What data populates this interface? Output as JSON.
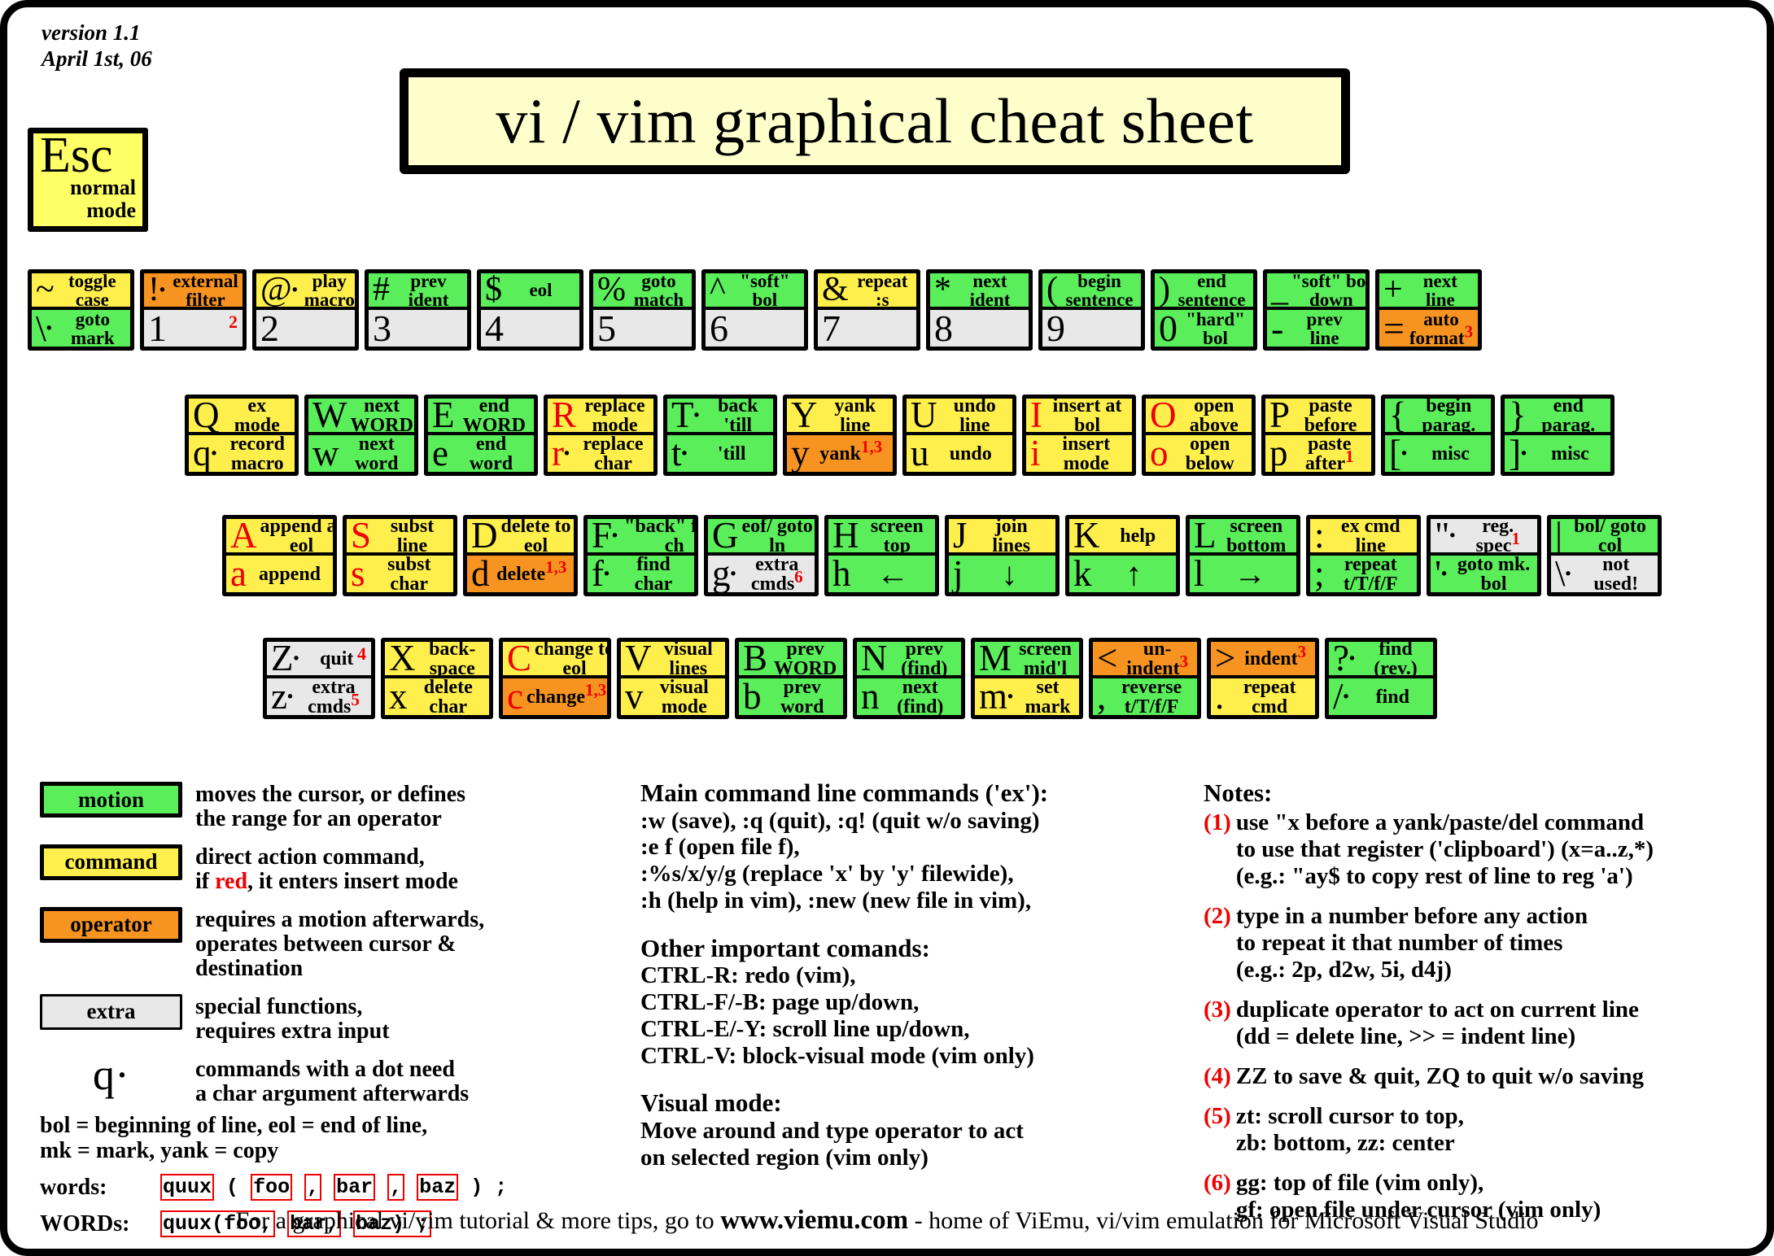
{
  "meta": {
    "version_line1": "version 1.1",
    "version_line2": "April 1st, 06",
    "title": "vi / vim graphical cheat sheet"
  },
  "esc_key": {
    "char": "Esc",
    "label_line1": "normal",
    "label_line2": "mode"
  },
  "rows": {
    "number_row": [
      {
        "top": {
          "char": "~",
          "label": "toggle case",
          "color": "command"
        },
        "bottom": {
          "char": "\\",
          "dot": true,
          "label": "goto mark",
          "color": "motion"
        }
      },
      {
        "top": {
          "char": "!",
          "dot": true,
          "label": "external filter",
          "color": "operator"
        },
        "bottom": {
          "char": "1",
          "label": "",
          "color": "plain",
          "corner_note": "2"
        }
      },
      {
        "top": {
          "char": "@",
          "dot": true,
          "label": "play macro",
          "color": "command"
        },
        "bottom": {
          "char": "2",
          "label": "",
          "color": "plain"
        }
      },
      {
        "top": {
          "char": "#",
          "label": "prev ident",
          "color": "motion"
        },
        "bottom": {
          "char": "3",
          "label": "",
          "color": "plain"
        }
      },
      {
        "top": {
          "char": "$",
          "label": "eol",
          "color": "motion"
        },
        "bottom": {
          "char": "4",
          "label": "",
          "color": "plain"
        }
      },
      {
        "top": {
          "char": "%",
          "label": "goto match",
          "color": "motion"
        },
        "bottom": {
          "char": "5",
          "label": "",
          "color": "plain"
        }
      },
      {
        "top": {
          "char": "^",
          "label": "\"soft\" bol",
          "color": "motion"
        },
        "bottom": {
          "char": "6",
          "label": "",
          "color": "plain"
        }
      },
      {
        "top": {
          "char": "&",
          "label": "repeat :s",
          "color": "command"
        },
        "bottom": {
          "char": "7",
          "label": "",
          "color": "plain"
        }
      },
      {
        "top": {
          "char": "*",
          "label": "next ident",
          "color": "motion"
        },
        "bottom": {
          "char": "8",
          "label": "",
          "color": "plain"
        }
      },
      {
        "top": {
          "char": "(",
          "label": "begin sentence",
          "color": "motion"
        },
        "bottom": {
          "char": "9",
          "label": "",
          "color": "plain"
        }
      },
      {
        "top": {
          "char": ")",
          "label": "end sentence",
          "color": "motion"
        },
        "bottom": {
          "char": "0",
          "label": "\"hard\" bol",
          "color": "motion"
        }
      },
      {
        "top": {
          "char": "_",
          "label": "\"soft\" bol down",
          "color": "motion",
          "label_above": true
        },
        "bottom": {
          "char": "-",
          "label": "prev line",
          "color": "motion"
        }
      },
      {
        "top": {
          "char": "+",
          "label": "next line",
          "color": "motion"
        },
        "bottom": {
          "char": "=",
          "label": "auto format",
          "color": "operator",
          "sup": "3"
        }
      }
    ],
    "q_row": [
      {
        "top": {
          "char": "Q",
          "label": "ex mode",
          "color": "command"
        },
        "bottom": {
          "char": "q",
          "dot": true,
          "label": "record macro",
          "color": "command"
        }
      },
      {
        "top": {
          "char": "W",
          "label": "next WORD",
          "color": "motion"
        },
        "bottom": {
          "char": "w",
          "label": "next word",
          "color": "motion"
        }
      },
      {
        "top": {
          "char": "E",
          "label": "end WORD",
          "color": "motion"
        },
        "bottom": {
          "char": "e",
          "label": "end word",
          "color": "motion"
        }
      },
      {
        "top": {
          "char": "R",
          "label": "replace mode",
          "color": "command",
          "red": true
        },
        "bottom": {
          "char": "r",
          "dot": true,
          "label": "replace char",
          "color": "command",
          "red": true
        }
      },
      {
        "top": {
          "char": "T",
          "dot": true,
          "label": "back 'till",
          "color": "motion"
        },
        "bottom": {
          "char": "t",
          "dot": true,
          "label": "'till",
          "color": "motion"
        }
      },
      {
        "top": {
          "char": "Y",
          "label": "yank line",
          "color": "command"
        },
        "bottom": {
          "char": "y",
          "label": "yank",
          "color": "operator",
          "sup": "1,3"
        }
      },
      {
        "top": {
          "char": "U",
          "label": "undo line",
          "color": "command"
        },
        "bottom": {
          "char": "u",
          "label": "undo",
          "color": "command"
        }
      },
      {
        "top": {
          "char": "I",
          "label": "insert at bol",
          "color": "command",
          "red": true
        },
        "bottom": {
          "char": "i",
          "label": "insert mode",
          "color": "command",
          "red": true
        }
      },
      {
        "top": {
          "char": "O",
          "label": "open above",
          "color": "command",
          "red": true
        },
        "bottom": {
          "char": "o",
          "label": "open below",
          "color": "command",
          "red": true
        }
      },
      {
        "top": {
          "char": "P",
          "label": "paste before",
          "color": "command"
        },
        "bottom": {
          "char": "p",
          "label": "paste after",
          "color": "command",
          "sup": "1"
        }
      },
      {
        "top": {
          "char": "{",
          "label": "begin parag.",
          "color": "motion"
        },
        "bottom": {
          "char": "[",
          "dot": true,
          "label": "misc",
          "color": "motion"
        }
      },
      {
        "top": {
          "char": "}",
          "label": "end parag.",
          "color": "motion"
        },
        "bottom": {
          "char": "]",
          "dot": true,
          "label": "misc",
          "color": "motion"
        }
      }
    ],
    "a_row": [
      {
        "top": {
          "char": "A",
          "label": "append at eol",
          "color": "command",
          "red": true
        },
        "bottom": {
          "char": "a",
          "label": "append",
          "color": "command",
          "red": true
        }
      },
      {
        "top": {
          "char": "S",
          "label": "subst line",
          "color": "command",
          "red": true
        },
        "bottom": {
          "char": "s",
          "label": "subst char",
          "color": "command",
          "red": true
        }
      },
      {
        "top": {
          "char": "D",
          "label": "delete to eol",
          "color": "command"
        },
        "bottom": {
          "char": "d",
          "label": "delete",
          "color": "operator",
          "sup": "1,3"
        }
      },
      {
        "top": {
          "char": "F",
          "dot": true,
          "label": "\"back\" find ch",
          "color": "motion"
        },
        "bottom": {
          "char": "f",
          "dot": true,
          "label": "find char",
          "color": "motion"
        }
      },
      {
        "top": {
          "char": "G",
          "label": "eof/ goto ln",
          "color": "motion"
        },
        "bottom": {
          "char": "g",
          "dot": true,
          "label": "extra cmds",
          "color": "extra",
          "sup": "6"
        }
      },
      {
        "top": {
          "char": "H",
          "label": "screen top",
          "color": "motion"
        },
        "bottom": {
          "char": "h",
          "label": "←",
          "color": "motion",
          "is_arrow": true
        }
      },
      {
        "top": {
          "char": "J",
          "label": "join lines",
          "color": "command"
        },
        "bottom": {
          "char": "j",
          "label": "↓",
          "color": "motion",
          "is_arrow": true
        }
      },
      {
        "top": {
          "char": "K",
          "label": "help",
          "color": "command"
        },
        "bottom": {
          "char": "k",
          "label": "↑",
          "color": "motion",
          "is_arrow": true
        }
      },
      {
        "top": {
          "char": "L",
          "label": "screen bottom",
          "color": "motion"
        },
        "bottom": {
          "char": "l",
          "label": "→",
          "color": "motion",
          "is_arrow": true
        }
      },
      {
        "top": {
          "char": ":",
          "label": "ex cmd line",
          "color": "command"
        },
        "bottom": {
          "char": ";",
          "label": "repeat t/T/f/F",
          "color": "motion"
        }
      },
      {
        "top": {
          "char": "\"",
          "dot": true,
          "label": "reg. spec",
          "color": "extra",
          "sup": "1"
        },
        "bottom": {
          "char": "'",
          "dot": true,
          "label": "goto mk. bol",
          "color": "motion"
        }
      },
      {
        "top": {
          "char": "|",
          "label": "bol/ goto col",
          "color": "motion"
        },
        "bottom": {
          "char": "\\",
          "dot": true,
          "label": "not used!",
          "color": "extra"
        }
      }
    ],
    "z_row": [
      {
        "top": {
          "char": "Z",
          "dot": true,
          "label": "quit",
          "color": "extra",
          "corner_note": "4"
        },
        "bottom": {
          "char": "z",
          "dot": true,
          "label": "extra cmds",
          "color": "extra",
          "sup": "5"
        }
      },
      {
        "top": {
          "char": "X",
          "label": "back- space",
          "color": "command"
        },
        "bottom": {
          "char": "x",
          "label": "delete char",
          "color": "command"
        }
      },
      {
        "top": {
          "char": "C",
          "label": "change to eol",
          "color": "command",
          "red": true
        },
        "bottom": {
          "char": "c",
          "label": "change",
          "color": "operator",
          "red": true,
          "sup": "1,3"
        }
      },
      {
        "top": {
          "char": "V",
          "label": "visual lines",
          "color": "command"
        },
        "bottom": {
          "char": "v",
          "label": "visual mode",
          "color": "command"
        }
      },
      {
        "top": {
          "char": "B",
          "label": "prev WORD",
          "color": "motion"
        },
        "bottom": {
          "char": "b",
          "label": "prev word",
          "color": "motion"
        }
      },
      {
        "top": {
          "char": "N",
          "label": "prev (find)",
          "color": "motion"
        },
        "bottom": {
          "char": "n",
          "label": "next (find)",
          "color": "motion"
        }
      },
      {
        "top": {
          "char": "M",
          "label": "screen mid'l",
          "color": "motion"
        },
        "bottom": {
          "char": "m",
          "dot": true,
          "label": "set mark",
          "color": "command"
        }
      },
      {
        "top": {
          "char": "<",
          "label": "un- indent",
          "color": "operator",
          "sup": "3"
        },
        "bottom": {
          "char": ",",
          "label": "reverse t/T/f/F",
          "color": "motion"
        }
      },
      {
        "top": {
          "char": ">",
          "label": "indent",
          "color": "operator",
          "sup": "3"
        },
        "bottom": {
          "char": ".",
          "label": "repeat cmd",
          "color": "command"
        }
      },
      {
        "top": {
          "char": "?",
          "dot": true,
          "label": "find (rev.)",
          "color": "motion"
        },
        "bottom": {
          "char": "/",
          "dot": true,
          "label": "find",
          "color": "motion"
        }
      }
    ]
  },
  "legend": {
    "items": [
      {
        "swatch": "motion",
        "color": "motion",
        "lines": [
          "moves the cursor, or defines",
          "the range for an operator"
        ]
      },
      {
        "swatch": "command",
        "color": "command",
        "lines": [
          "direct action command,",
          "if red, it enters insert mode"
        ],
        "has_red": true
      },
      {
        "swatch": "operator",
        "color": "operator",
        "lines": [
          "requires a motion afterwards,",
          "operates between cursor  &",
          "destination"
        ]
      },
      {
        "swatch": "extra",
        "color": "extra",
        "lines": [
          "special functions,",
          "requires extra input"
        ]
      }
    ],
    "dot_note": {
      "glyph": "q·",
      "lines": [
        "commands with a dot need",
        "a char argument afterwards"
      ]
    },
    "definitions": [
      "bol = beginning of line, eol = end of line,",
      "mk = mark, yank = copy"
    ],
    "words_label": "words:",
    "words_parts": [
      "quux",
      "(",
      "foo",
      ",",
      "bar",
      ",",
      "baz",
      ") ;"
    ],
    "words_boxed": [
      true,
      false,
      true,
      true,
      true,
      true,
      true,
      false
    ],
    "wordsup_label": "WORDs:",
    "wordsup_parts": [
      "quux(foo,",
      "bar,",
      "baz) ;"
    ],
    "wordsup_boxed": [
      true,
      true,
      true
    ]
  },
  "middle": {
    "ex_heading": "Main command line commands ('ex'):",
    "ex_lines": [
      ":w (save), :q (quit), :q! (quit w/o saving)",
      ":e f (open file f),",
      ":%s/x/y/g (replace 'x' by 'y' filewide),",
      ":h (help in vim), :new (new file in vim),"
    ],
    "other_heading": "Other important comands:",
    "other_lines": [
      "CTRL-R: redo (vim),",
      "CTRL-F/-B: page up/down,",
      "CTRL-E/-Y: scroll line up/down,",
      "CTRL-V: block-visual mode (vim only)"
    ],
    "visual_heading": "Visual mode:",
    "visual_lines": [
      "Move around and type operator to act",
      "on selected region (vim only)"
    ]
  },
  "notes": {
    "heading": "Notes:",
    "items": [
      {
        "n": "(1)",
        "lines": [
          "use \"x before a yank/paste/del command",
          "to use that register ('clipboard') (x=a..z,*)",
          "(e.g.: \"ay$ to copy rest of line to reg 'a')"
        ]
      },
      {
        "n": "(2)",
        "lines": [
          "type in a number before any action",
          "to repeat it that number of times",
          "(e.g.: 2p, d2w, 5i, d4j)"
        ]
      },
      {
        "n": "(3)",
        "lines": [
          "duplicate operator to act on current line",
          "(dd = delete line, >> = indent line)"
        ]
      },
      {
        "n": "(4)",
        "lines": [
          "ZZ to save & quit, ZQ to quit w/o saving"
        ]
      },
      {
        "n": "(5)",
        "lines": [
          "zt: scroll cursor to top,",
          "zb: bottom, zz: center"
        ]
      },
      {
        "n": "(6)",
        "lines": [
          "gg: top of file (vim only),",
          "gf: open file under cursor (vim only)"
        ]
      }
    ]
  },
  "footer": {
    "pre": "For a graphical vi/vim tutorial & more tips, go to",
    "site": "www.viemu.com",
    "post": "- home of ViEmu, vi/vim emulation for Microsoft Visual Studio"
  },
  "colors": {
    "motion": "#5aee5a",
    "command": "#ffef4d",
    "operator": "#f79421",
    "extra": "#e8e8e8",
    "red": "#ee0000",
    "title_bg": "#ffffcc"
  }
}
